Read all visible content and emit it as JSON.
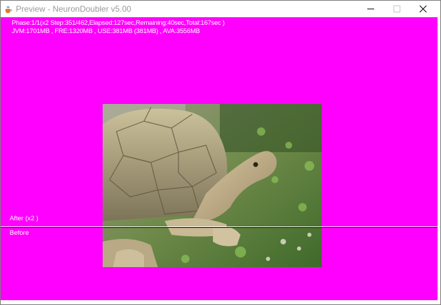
{
  "window": {
    "title": "Preview - NeuronDoubler v5.00"
  },
  "status": {
    "phase_line": "Phase:1/1(x2 Step:351/462,Elapsed:127sec,Remaining:40sec,Total:167sec )",
    "memory_line": "JVM:1701MB , FRE:1320MB , USE:381MB (381MB) , AVA:3556MB"
  },
  "preview": {
    "after_label": "After (x2 )",
    "before_label": "Before"
  },
  "colors": {
    "background": "#ff00ff",
    "text": "#ffffff"
  },
  "icons": {
    "app": "java-cup-icon",
    "minimize": "minimize-icon",
    "maximize": "maximize-icon",
    "close": "close-icon"
  }
}
